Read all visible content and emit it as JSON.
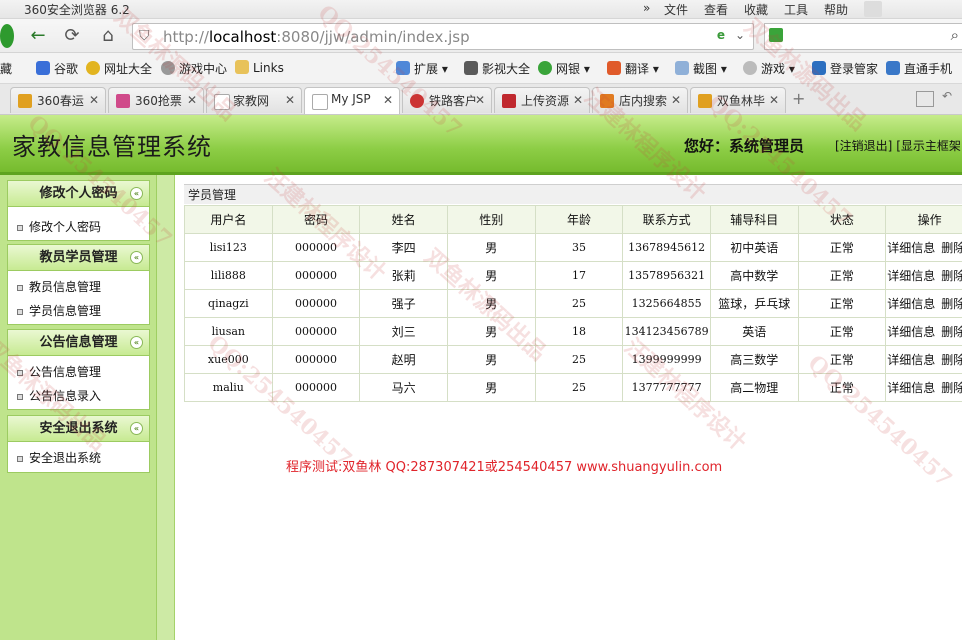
{
  "browser": {
    "title": "360安全浏览器 6.2",
    "menu": [
      "文件",
      "查看",
      "收藏",
      "工具",
      "帮助"
    ],
    "url_prefix": "http://",
    "url_host": "localhost",
    "url_rest": ":8080/jjw/admin/index.jsp",
    "favorites": [
      "藏",
      "谷歌",
      "网址大全",
      "游戏中心",
      "Links",
      "扩展",
      "影视大全",
      "网银",
      "翻译",
      "截图",
      "游戏",
      "登录管家",
      "直通手机"
    ],
    "tabs": [
      {
        "label": "360春运",
        "color": "#e0a020"
      },
      {
        "label": "360抢票",
        "color": "#d04a8a"
      },
      {
        "label": "家教网",
        "color": "#dddddd"
      },
      {
        "label": "My JSP",
        "color": "#dddddd"
      },
      {
        "label": "铁路客户",
        "color": "#cc3333"
      },
      {
        "label": "上传资源",
        "color": "#c0282e"
      },
      {
        "label": "店内搜索",
        "color": "#e07a20"
      },
      {
        "label": "双鱼林毕",
        "color": "#e0a020"
      }
    ]
  },
  "app": {
    "title": "家教信息管理系统",
    "greeting": "您好：系统管理员",
    "logout_link": "[注销退出]",
    "show_frame_link": "[显示主框架"
  },
  "sidebar": {
    "groups": [
      {
        "title": "修改个人密码",
        "items": [
          "修改个人密码"
        ]
      },
      {
        "title": "教员学员管理",
        "items": [
          "教员信息管理",
          "学员信息管理"
        ]
      },
      {
        "title": "公告信息管理",
        "items": [
          "公告信息管理",
          "公告信息录入"
        ]
      },
      {
        "title": "安全退出系统",
        "items": [
          "安全退出系统"
        ]
      }
    ],
    "toggle_icon": "«"
  },
  "main": {
    "panel_title": "学员管理",
    "columns": [
      "用户名",
      "密码",
      "姓名",
      "性别",
      "年龄",
      "联系方式",
      "辅导科目",
      "状态",
      "操作"
    ],
    "rows": [
      [
        "lisi123",
        "000000",
        "李四",
        "男",
        "35",
        "13678945612",
        "初中英语",
        "正常"
      ],
      [
        "lili888",
        "000000",
        "张莉",
        "男",
        "17",
        "13578956321",
        "高中数学",
        "正常"
      ],
      [
        "qinagzi",
        "000000",
        "强子",
        "男",
        "25",
        "1325664855",
        "篮球，乒乓球",
        "正常"
      ],
      [
        "liusan",
        "000000",
        "刘三",
        "男",
        "18",
        "134123456789",
        "英语",
        "正常"
      ],
      [
        "xue000",
        "000000",
        "赵明",
        "男",
        "25",
        "1399999999",
        "高三数学",
        "正常"
      ],
      [
        "maliu",
        "000000",
        "马六",
        "男",
        "25",
        "1377777777",
        "高二物理",
        "正常"
      ]
    ],
    "action_detail": "详细信息",
    "action_delete": "删除",
    "credit": "程序测试:双鱼林 QQ:287307421或254540457 www.shuangyulin.com"
  },
  "watermarks": [
    "双鱼林源码出品",
    "QQ:254540457",
    "汪建林程序设计",
    "双鱼林源码出品",
    "QQ:254540457",
    "汪建林程序设计",
    "双鱼林源码出品",
    "QQ:254540457",
    "双鱼林源码出品",
    "QQ:254540457",
    "汪建林程序设计",
    "QQ:254540457"
  ]
}
